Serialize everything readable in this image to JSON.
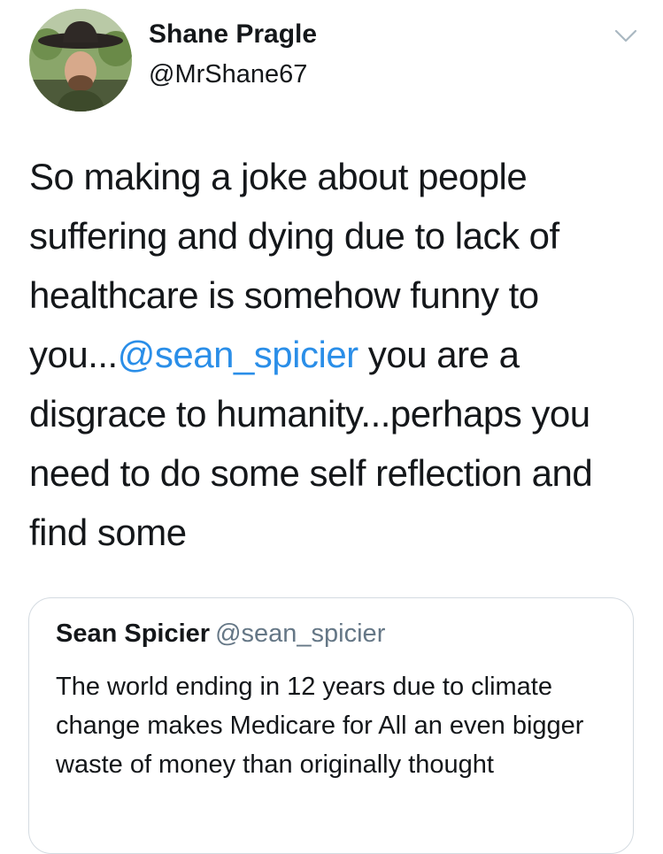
{
  "tweet": {
    "author": {
      "name": "Shane Pragle",
      "handle": "@MrShane67"
    },
    "text_before_mention": "So making a joke about people suffering and dying due to lack of healthcare is somehow funny to you...",
    "mention": "@sean_spicier",
    "text_after_mention": " you are a disgrace to humanity...perhaps you need to do some self reflection and find some",
    "menu_icon": "chevron-down-icon"
  },
  "quoted_tweet": {
    "author": {
      "name": "Sean Spicier",
      "handle": "@sean_spicier"
    },
    "text": "The world ending in 12 years due to climate change makes Medicare for All an even bigger waste of money than originally thought"
  },
  "colors": {
    "text": "#14171a",
    "link": "#2a8ee8",
    "secondary": "#657786",
    "border": "#d4dbe1",
    "background": "#ffffff"
  }
}
